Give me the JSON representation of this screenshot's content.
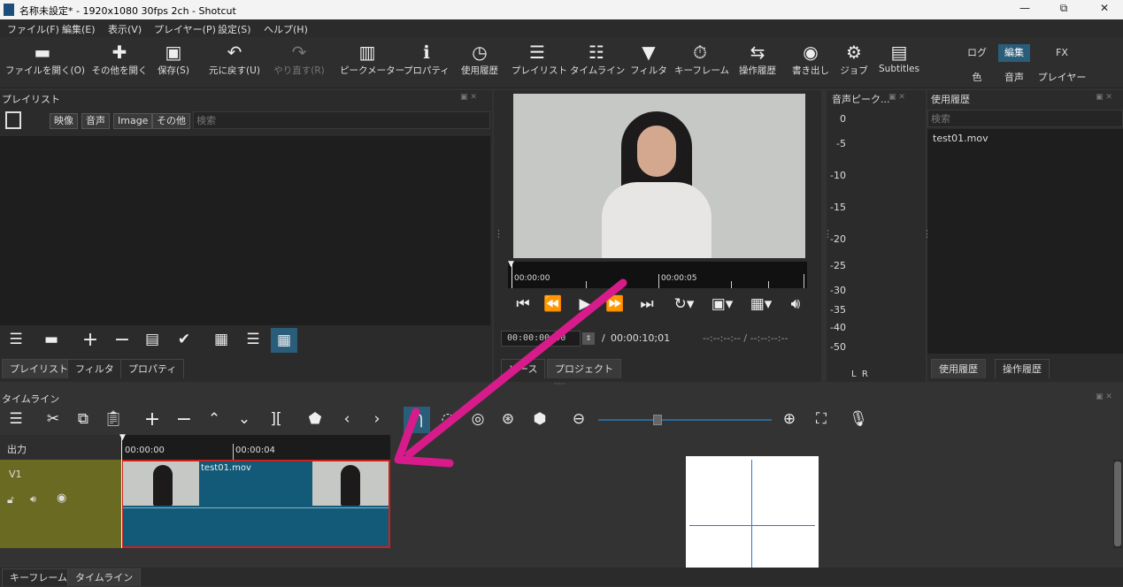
{
  "window": {
    "title": "名称未設定* - 1920x1080 30fps 2ch - Shotcut",
    "controls": {
      "minimize": "—",
      "maximize": "⧉",
      "close": "✕"
    }
  },
  "menu": [
    "ファイル(F)",
    "編集(E)",
    "表示(V)",
    "プレイヤー(P)",
    "設定(S)",
    "ヘルプ(H)"
  ],
  "toolbar": {
    "open_file": "ファイルを開く(O)",
    "open_other": "その他を開く",
    "save": "保存(S)",
    "undo": "元に戻す(U)",
    "redo": "やり直す(R)",
    "peak_meter": "ピークメーター",
    "properties": "プロパティ",
    "recent": "使用履歴",
    "playlist": "プレイリスト",
    "timeline": "タイムライン",
    "filters": "フィルタ",
    "keyframes": "キーフレーム",
    "history": "操作履歴",
    "export": "書き出し",
    "jobs": "ジョブ",
    "subtitles": "Subtitles"
  },
  "modes": {
    "log": "ログ",
    "edit": "編集",
    "fx": "FX",
    "color": "色",
    "audio": "音声",
    "player": "プレイヤー"
  },
  "playlist_panel": {
    "title": "プレイリスト",
    "filters": [
      "映像",
      "音声",
      "Image",
      "その他"
    ],
    "search_placeholder": "検索",
    "tabs": [
      "プレイリスト",
      "フィルタ",
      "プロパティ"
    ]
  },
  "player": {
    "ruler_labels": [
      "00:00:00",
      "00:00:05"
    ],
    "timecode": "00:00:00;00",
    "duration": "00:00:10;01",
    "in_out": "--:--:--:-- / --:--:--:--",
    "tabs": [
      "ソース",
      "プロジェクト"
    ]
  },
  "audio_meter": {
    "title": "音声ピーク...",
    "scale": [
      "0",
      "-5",
      "-10",
      "-15",
      "-20",
      "-25",
      "-30",
      "-35",
      "-40",
      "-50"
    ],
    "channels": "L  R"
  },
  "recent_panel": {
    "title": "使用履歴",
    "search_placeholder": "検索",
    "items": [
      "test01.mov"
    ],
    "tabs": [
      "使用履歴",
      "操作履歴"
    ]
  },
  "timeline": {
    "title": "タイムライン",
    "output_label": "出力",
    "ruler_labels": [
      "00:00:00",
      "00:00:04"
    ],
    "track_name": "V1",
    "clip_name": "test01.mov"
  },
  "bottom_tabs": [
    "キーフレーム",
    "タイムライン"
  ],
  "colors": {
    "accent": "#2a5d7a",
    "arrow": "#d81b8a",
    "clip": "#125a78",
    "track_header": "#6b6a23"
  }
}
